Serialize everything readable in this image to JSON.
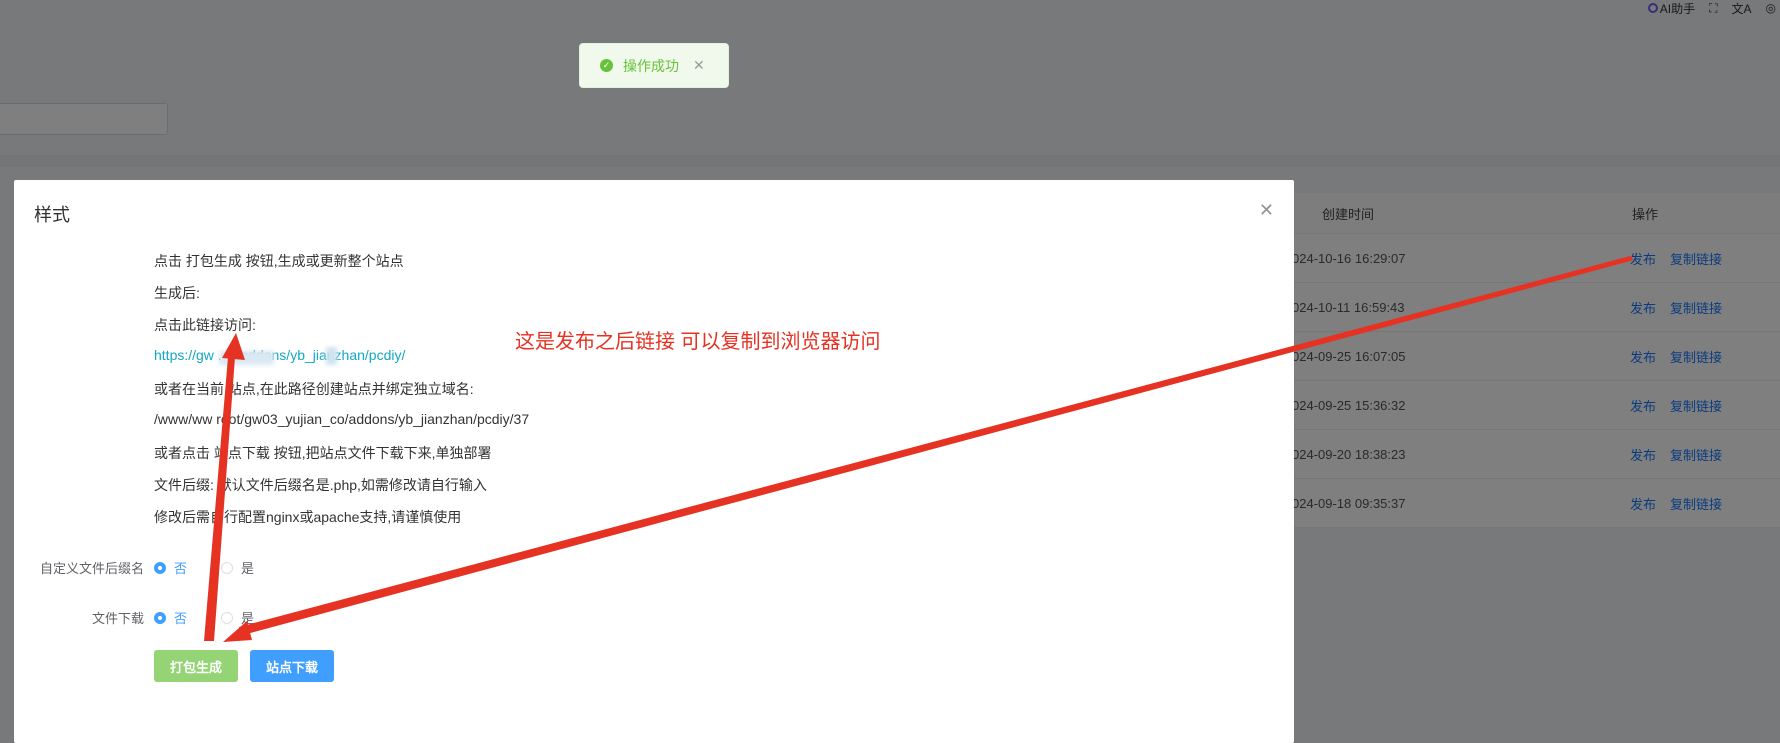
{
  "top_toolbar": {
    "ai_label": "AI助手",
    "fullscreen_icon": "fullscreen-icon",
    "translate_icon": "translate-icon"
  },
  "table": {
    "columns": {
      "created": "创建时间",
      "actions": "操作"
    },
    "rows": [
      {
        "created": "024-10-16 16:29:07"
      },
      {
        "created": "024-10-11 16:59:43"
      },
      {
        "created": "024-09-25 16:07:05"
      },
      {
        "created": "024-09-25 15:36:32"
      },
      {
        "created": "024-09-20 18:38:23"
      },
      {
        "created": "024-09-18 09:35:37"
      }
    ],
    "publish_label": "发布",
    "copy_link_label": "复制链接"
  },
  "toast": {
    "text": "操作成功"
  },
  "dialog": {
    "title": "样式",
    "lines": {
      "l1": "点击 打包生成 按钮,生成或更新整个站点",
      "l2": "生成后:",
      "l3": "点击此链接访问:",
      "link": "https://gw                .co/addons/yb_jianzhan/pcdiy/",
      "l5": "或者在当前 站点,在此路径创建站点并绑定独立域名:",
      "l6": "/www/ww   root/gw03_yujian_co/addons/yb_jianzhan/pcdiy/37",
      "l7": "或者点击  站点下载 按钮,把站点文件下载下来,单独部署",
      "l8": "文件后缀:  默认文件后缀名是.php,如需修改请自行输入",
      "l9": "修改后需自行配置nginx或apache支持,请谨慎使用"
    },
    "annotation": "这是发布之后链接  可以复制到浏览器访问",
    "form": {
      "suffix_label": "自定义文件后缀名",
      "download_label": "文件下载",
      "no": "否",
      "yes": "是"
    },
    "buttons": {
      "pack": "打包生成",
      "download": "站点下载"
    }
  },
  "colors": {
    "primary": "#409eff",
    "success": "#67c23a",
    "annotation_red": "#e53222",
    "link": "#13a8c3"
  }
}
